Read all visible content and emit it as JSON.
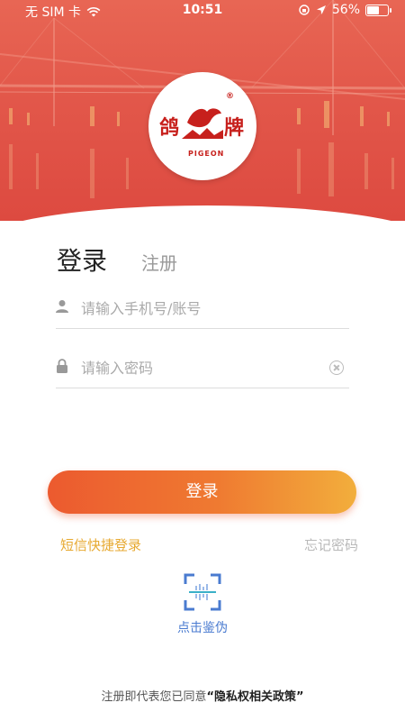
{
  "status_bar": {
    "carrier": "无 SIM 卡",
    "time": "10:51",
    "battery_percent": "56%",
    "battery_level": 0.56
  },
  "logo": {
    "left_char": "鸽",
    "right_char": "牌",
    "english": "PIGEON",
    "registered": "®"
  },
  "tabs": {
    "login": "登录",
    "register": "注册"
  },
  "form": {
    "account_placeholder": "请输入手机号/账号",
    "password_placeholder": "请输入密码"
  },
  "buttons": {
    "login": "登录",
    "sms_login": "短信快捷登录",
    "forgot_password": "忘记密码",
    "verify": "点击鉴伪"
  },
  "footer": {
    "prefix": "注册即代表您已同意",
    "policy": "“隐私权相关政策”"
  },
  "colors": {
    "brand_red": "#c7201c",
    "button_start": "#ec5a2f",
    "button_end": "#f2ae3c",
    "sms_link": "#e7a931",
    "verify_blue": "#4a7bd0"
  },
  "icons": {
    "wifi": "wifi-icon",
    "location": "location-arrow-icon",
    "lock_rotation": "orientation-lock-icon",
    "user": "user-icon",
    "password": "lock-icon",
    "clear": "clear-icon",
    "scan": "scan-icon"
  }
}
